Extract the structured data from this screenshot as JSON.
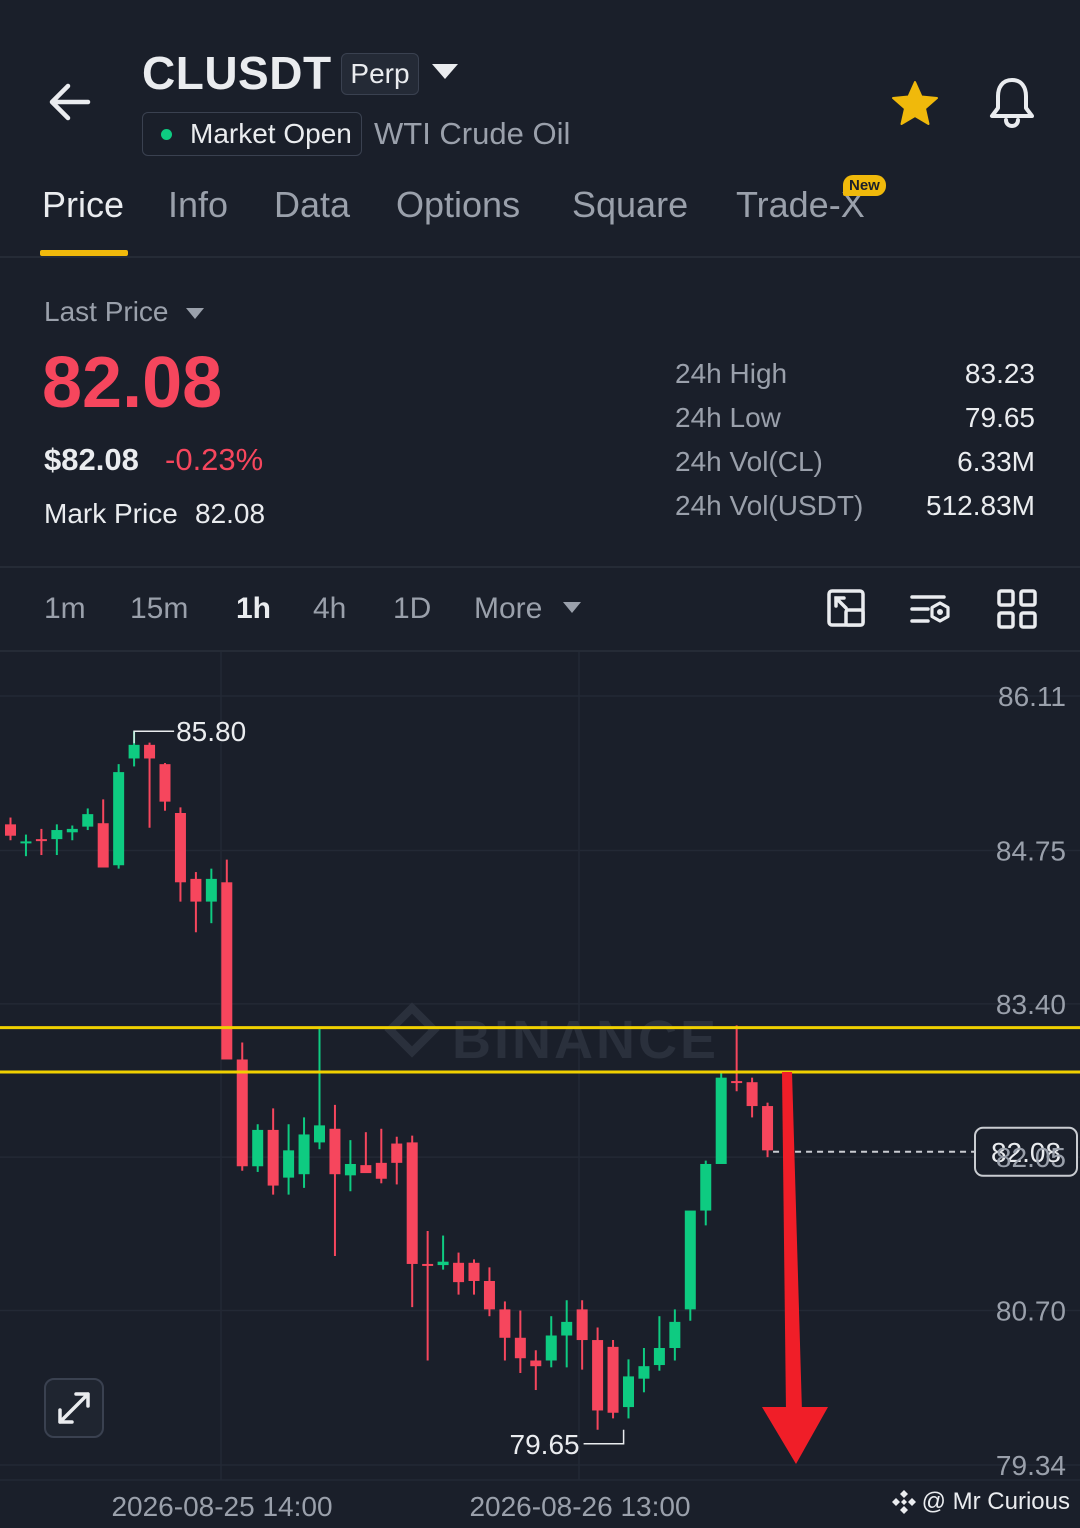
{
  "header": {
    "symbol": "CLUSDT",
    "contract_type": "Perp",
    "market_status": "Market Open",
    "asset_name": "WTI Crude Oil",
    "colors": {
      "favorite": "#f0b90b",
      "status_dot": "#0ecb81"
    }
  },
  "tabs": [
    {
      "label": "Price",
      "active": true
    },
    {
      "label": "Info"
    },
    {
      "label": "Data"
    },
    {
      "label": "Options"
    },
    {
      "label": "Square"
    },
    {
      "label": "Trade-X",
      "badge": "New"
    }
  ],
  "price": {
    "selector_label": "Last Price",
    "last_price": "82.08",
    "usd_price": "$82.08",
    "change_pct": "-0.23%",
    "mark_label": "Mark Price",
    "mark_value": "82.08"
  },
  "stats": [
    {
      "label": "24h High",
      "value": "83.23"
    },
    {
      "label": "24h Low",
      "value": "79.65"
    },
    {
      "label": "24h Vol(CL)",
      "value": "6.33M"
    },
    {
      "label": "24h Vol(USDT)",
      "value": "512.83M"
    }
  ],
  "intervals": {
    "items": [
      "1m",
      "15m",
      "1h",
      "4h",
      "1D"
    ],
    "active": "1h",
    "more_label": "More"
  },
  "chart_data": {
    "type": "candlestick",
    "interval": "1h",
    "y_ticks": [
      "86.11",
      "84.75",
      "83.40",
      "82.05",
      "80.70",
      "79.34"
    ],
    "ylim": [
      79.34,
      86.11
    ],
    "x_ticks": [
      "2026-08-25 14:00",
      "2026-08-26 13:00"
    ],
    "current_price_label": "82.08",
    "high_marker": "85.80",
    "low_marker": "79.65",
    "watermark": "BINANCE",
    "horizontal_lines": [
      83.19,
      82.8
    ],
    "colors": {
      "up": "#0ecb81",
      "down": "#f6465d",
      "lines": "#f0d000",
      "arrow": "#f01e28"
    },
    "candles": [
      {
        "o": 84.98,
        "h": 85.04,
        "l": 84.84,
        "c": 84.88
      },
      {
        "o": 84.83,
        "h": 84.89,
        "l": 84.7,
        "c": 84.83
      },
      {
        "o": 84.85,
        "h": 84.94,
        "l": 84.71,
        "c": 84.84
      },
      {
        "o": 84.85,
        "h": 84.98,
        "l": 84.71,
        "c": 84.93
      },
      {
        "o": 84.91,
        "h": 84.97,
        "l": 84.84,
        "c": 84.94
      },
      {
        "o": 84.96,
        "h": 85.12,
        "l": 84.93,
        "c": 85.07
      },
      {
        "o": 84.99,
        "h": 85.2,
        "l": 84.6,
        "c": 84.6
      },
      {
        "o": 84.62,
        "h": 85.51,
        "l": 84.59,
        "c": 85.44
      },
      {
        "o": 85.56,
        "h": 85.8,
        "l": 85.49,
        "c": 85.68
      },
      {
        "o": 85.68,
        "h": 85.7,
        "l": 84.95,
        "c": 85.56
      },
      {
        "o": 85.51,
        "h": 85.52,
        "l": 85.1,
        "c": 85.18
      },
      {
        "o": 85.08,
        "h": 85.13,
        "l": 84.3,
        "c": 84.47
      },
      {
        "o": 84.5,
        "h": 84.56,
        "l": 84.03,
        "c": 84.3
      },
      {
        "o": 84.3,
        "h": 84.59,
        "l": 84.11,
        "c": 84.5
      },
      {
        "o": 84.47,
        "h": 84.67,
        "l": 83.69,
        "c": 82.91
      },
      {
        "o": 82.91,
        "h": 83.06,
        "l": 81.93,
        "c": 81.97
      },
      {
        "o": 81.97,
        "h": 82.34,
        "l": 81.92,
        "c": 82.29
      },
      {
        "o": 82.29,
        "h": 82.48,
        "l": 81.72,
        "c": 81.8
      },
      {
        "o": 81.87,
        "h": 82.34,
        "l": 81.72,
        "c": 82.11
      },
      {
        "o": 81.9,
        "h": 82.4,
        "l": 81.78,
        "c": 82.25
      },
      {
        "o": 82.18,
        "h": 83.18,
        "l": 82.12,
        "c": 82.33
      },
      {
        "o": 82.3,
        "h": 82.51,
        "l": 81.18,
        "c": 81.9
      },
      {
        "o": 81.89,
        "h": 82.2,
        "l": 81.75,
        "c": 81.99
      },
      {
        "o": 81.98,
        "h": 82.27,
        "l": 81.92,
        "c": 81.91
      },
      {
        "o": 82.0,
        "h": 82.3,
        "l": 81.82,
        "c": 81.86
      },
      {
        "o": 82.17,
        "h": 82.23,
        "l": 81.81,
        "c": 82.0
      },
      {
        "o": 82.18,
        "h": 82.24,
        "l": 80.73,
        "c": 81.11
      },
      {
        "o": 81.11,
        "h": 81.4,
        "l": 80.26,
        "c": 81.1
      },
      {
        "o": 81.1,
        "h": 81.36,
        "l": 81.06,
        "c": 81.13
      },
      {
        "o": 81.12,
        "h": 81.21,
        "l": 80.84,
        "c": 80.95
      },
      {
        "o": 81.12,
        "h": 81.15,
        "l": 80.84,
        "c": 80.96
      },
      {
        "o": 80.96,
        "h": 81.08,
        "l": 80.65,
        "c": 80.71
      },
      {
        "o": 80.71,
        "h": 80.78,
        "l": 80.26,
        "c": 80.46
      },
      {
        "o": 80.46,
        "h": 80.7,
        "l": 80.15,
        "c": 80.28
      },
      {
        "o": 80.26,
        "h": 80.35,
        "l": 80.0,
        "c": 80.21
      },
      {
        "o": 80.26,
        "h": 80.65,
        "l": 80.2,
        "c": 80.48
      },
      {
        "o": 80.48,
        "h": 80.79,
        "l": 80.2,
        "c": 80.6
      },
      {
        "o": 80.71,
        "h": 80.79,
        "l": 80.18,
        "c": 80.44
      },
      {
        "o": 80.44,
        "h": 80.55,
        "l": 79.65,
        "c": 79.82
      },
      {
        "o": 80.38,
        "h": 80.44,
        "l": 79.75,
        "c": 79.8
      },
      {
        "o": 79.85,
        "h": 80.27,
        "l": 79.75,
        "c": 80.12
      },
      {
        "o": 80.1,
        "h": 80.37,
        "l": 79.98,
        "c": 80.21
      },
      {
        "o": 80.22,
        "h": 80.65,
        "l": 80.17,
        "c": 80.37
      },
      {
        "o": 80.37,
        "h": 80.71,
        "l": 80.26,
        "c": 80.6
      },
      {
        "o": 80.71,
        "h": 81.21,
        "l": 80.61,
        "c": 81.58
      },
      {
        "o": 81.58,
        "h": 82.02,
        "l": 81.45,
        "c": 81.99
      },
      {
        "o": 81.99,
        "h": 82.8,
        "l": 82.02,
        "c": 82.75
      },
      {
        "o": 82.72,
        "h": 83.21,
        "l": 82.63,
        "c": 82.71
      },
      {
        "o": 82.71,
        "h": 82.75,
        "l": 82.4,
        "c": 82.5
      },
      {
        "o": 82.5,
        "h": 82.53,
        "l": 82.05,
        "c": 82.11
      }
    ]
  },
  "footer": {
    "credit": "@ Mr Curious"
  }
}
